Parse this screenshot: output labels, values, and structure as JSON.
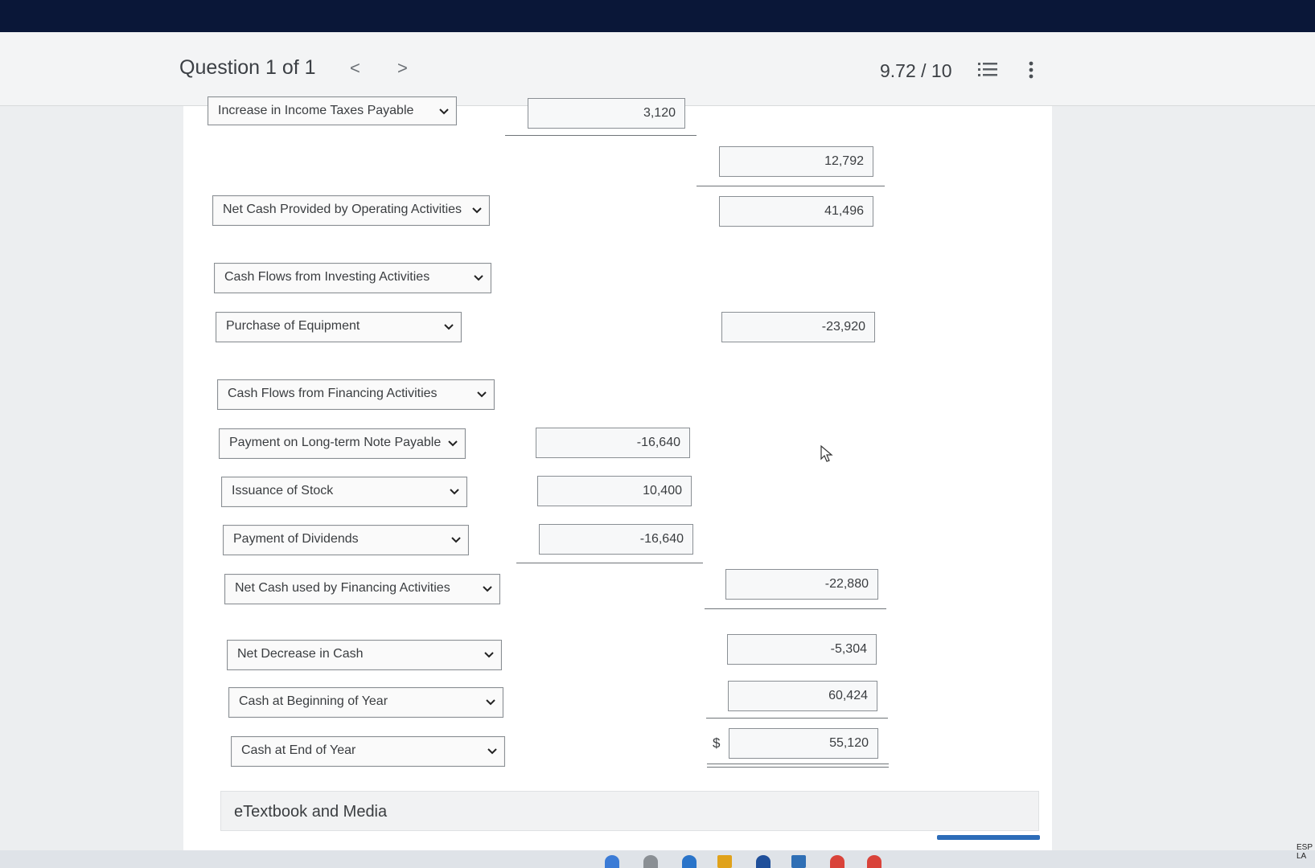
{
  "header": {
    "question_label": "Question 1 of 1",
    "prev_glyph": "<",
    "next_glyph": ">",
    "score": "9.72 / 10"
  },
  "rows": {
    "income_taxes": {
      "label": "Increase in Income Taxes Payable",
      "value": "3,120"
    },
    "subtotal_adjustments": {
      "value": "12,792"
    },
    "net_operating": {
      "label": "Net Cash Provided by Operating Activities",
      "value": "41,496"
    },
    "investing_header": {
      "label": "Cash Flows from Investing Activities"
    },
    "purchase_equipment": {
      "label": "Purchase of Equipment",
      "value": "-23,920"
    },
    "financing_header": {
      "label": "Cash Flows from Financing Activities"
    },
    "payment_note": {
      "label": "Payment on Long-term Note Payable",
      "value": "-16,640"
    },
    "issuance_stock": {
      "label": "Issuance of Stock",
      "value": "10,400"
    },
    "payment_dividends": {
      "label": "Payment of Dividends",
      "value": "-16,640"
    },
    "net_financing": {
      "label": "Net Cash used by Financing Activities",
      "value": "-22,880"
    },
    "net_decrease": {
      "label": "Net Decrease in Cash",
      "value": "-5,304"
    },
    "cash_beginning": {
      "label": "Cash at Beginning of Year",
      "value": "60,424"
    },
    "cash_end": {
      "label": "Cash at End of Year",
      "value": "55,120",
      "currency": "$"
    }
  },
  "etextbook": {
    "label": "eTextbook and Media"
  },
  "tray": {
    "lang_line1": "ESP",
    "lang_line2": "LA"
  },
  "colors": {
    "header_bg": "#f3f4f5",
    "bezel": "#0a1738",
    "accent_blue": "#2d6cb8"
  },
  "icons": [
    "list-icon",
    "more-vertical-icon",
    "chevron-down-icon",
    "pointer-cursor-icon"
  ]
}
